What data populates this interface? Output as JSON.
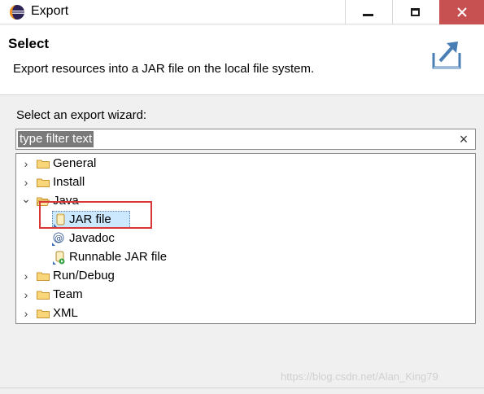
{
  "window": {
    "title": "Export",
    "minimize_icon": "minimize-icon",
    "maximize_icon": "maximize-icon",
    "close_icon": "close-icon",
    "close_color": "#c75050"
  },
  "header": {
    "title": "Select",
    "description": "Export resources into a JAR file on the local file system."
  },
  "wizard": {
    "prompt": "Select an export wizard:",
    "filter": {
      "value": "type filter text",
      "placeholder": "type filter text",
      "clear_icon": "×"
    },
    "tree": [
      {
        "label": "General",
        "expander": "›",
        "icon": "folder-icon",
        "level": 0
      },
      {
        "label": "Install",
        "expander": "›",
        "icon": "folder-icon",
        "level": 0
      },
      {
        "label": "Java",
        "expander": "⌄",
        "icon": "folder-open-icon",
        "level": 0
      },
      {
        "label": "JAR file",
        "expander": "",
        "icon": "jar-file-icon",
        "level": 1,
        "selected": true
      },
      {
        "label": "Javadoc",
        "expander": "",
        "icon": "javadoc-icon",
        "level": 1
      },
      {
        "label": "Runnable JAR file",
        "expander": "",
        "icon": "runnable-jar-icon",
        "level": 1
      },
      {
        "label": "Run/Debug",
        "expander": "›",
        "icon": "folder-icon",
        "level": 0
      },
      {
        "label": "Team",
        "expander": "›",
        "icon": "folder-icon",
        "level": 0
      },
      {
        "label": "XML",
        "expander": "›",
        "icon": "folder-icon",
        "level": 0
      }
    ]
  },
  "annotation_color": "#d93737",
  "watermark": "https://blog.csdn.net/Alan_King79"
}
